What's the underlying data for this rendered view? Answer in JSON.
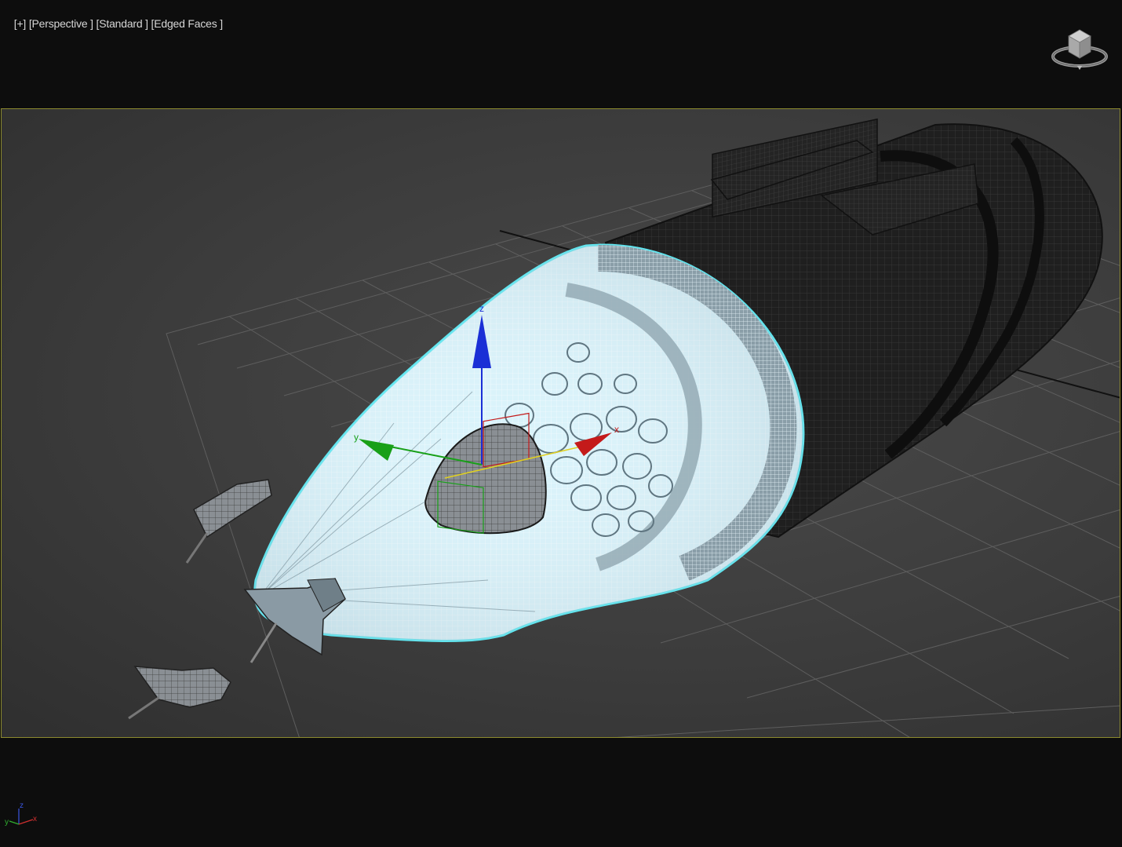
{
  "viewport": {
    "label_plus": "[+]",
    "label_view": "[Perspective ]",
    "label_shading": "[Standard ]",
    "label_display": "[Edged Faces ]"
  },
  "gizmo": {
    "axis_x_label": "x",
    "axis_y_label": "y",
    "axis_z_label": "z",
    "color_x": "#c41a1a",
    "color_y": "#18a018",
    "color_z": "#1a2fd6",
    "plane_color": "#e0d020"
  },
  "tripod": {
    "x_label": "x",
    "y_label": "y",
    "z_label": "z"
  },
  "colors": {
    "selection_outline": "#5fe6f0",
    "selected_fill": "#d9f3fb",
    "safe_frame": "#8c8a2e",
    "mesh_dark": "#262626",
    "grid": "#5a5a5a"
  },
  "icons": {
    "viewcube": "viewcube-icon",
    "tripod": "axis-tripod-icon"
  }
}
